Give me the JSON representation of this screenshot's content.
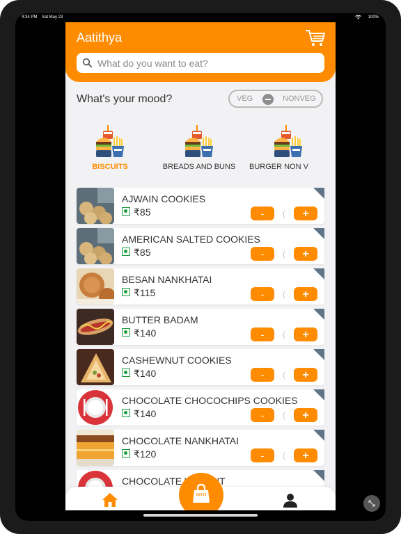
{
  "status_bar": {
    "time": "4:34 PM",
    "date": "Sat May 23",
    "battery": "100%"
  },
  "header": {
    "title": "Aatithya",
    "cart_icon": "cart-icon"
  },
  "search": {
    "placeholder": "What do you want to eat?"
  },
  "mood": {
    "label": "What's your mood?",
    "veg_label": "VEG",
    "nonveg_label": "NONVEG"
  },
  "categories": [
    {
      "label": "BISCUITS",
      "active": true
    },
    {
      "label": "BREADS AND BUNS",
      "active": false
    },
    {
      "label": "BURGER NON V",
      "active": false
    }
  ],
  "items": [
    {
      "name": "AJWAIN COOKIES",
      "price": "₹85"
    },
    {
      "name": "AMERICAN SALTED COOKIES",
      "price": "₹85"
    },
    {
      "name": "BESAN NANKHATAI",
      "price": "₹115"
    },
    {
      "name": "BUTTER BADAM",
      "price": "₹140"
    },
    {
      "name": "CASHEWNUT COOKIES",
      "price": "₹140"
    },
    {
      "name": "CHOCOLATE CHOCOCHIPS COOKIES",
      "price": "₹140"
    },
    {
      "name": "CHOCOLATE NANKHATAI",
      "price": "₹120"
    },
    {
      "name": "CHOCOLATE WALNUT",
      "price": ""
    }
  ],
  "stepper": {
    "minus_label": "-",
    "plus_label": "+",
    "qty_label": "("
  },
  "colors": {
    "brand": "#ff8c00",
    "veg_green": "#1a9b3b",
    "corner_badge": "#5f7587"
  }
}
